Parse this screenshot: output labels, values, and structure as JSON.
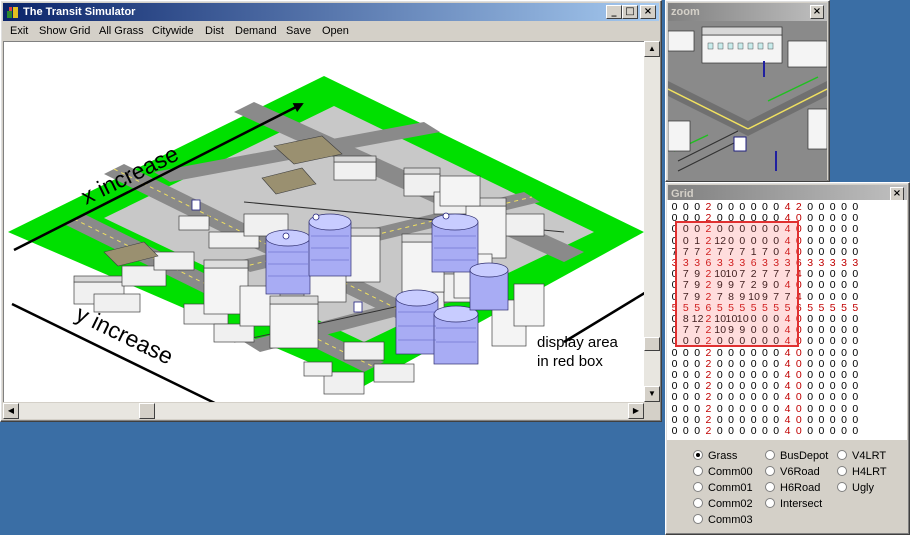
{
  "main_window": {
    "title": "The Transit Simulator",
    "menu": [
      "Exit",
      "Show Grid",
      "All Grass",
      "Citywide",
      "Dist",
      "Demand",
      "Save",
      "Open"
    ]
  },
  "zoom_window": {
    "title": "zoom"
  },
  "grid_window": {
    "title": "Grid",
    "rows": [
      [
        "0",
        "0",
        "0",
        "2",
        "0",
        "0",
        "0",
        "0",
        "0",
        "0",
        "4",
        "2",
        "0",
        "0",
        "0",
        "0",
        "0"
      ],
      [
        "0",
        "0",
        "0",
        "2",
        "0",
        "0",
        "0",
        "0",
        "0",
        "0",
        "4",
        "0",
        "0",
        "0",
        "0",
        "0",
        "0"
      ],
      [
        "0",
        "0",
        "0",
        "2",
        "0",
        "0",
        "0",
        "0",
        "0",
        "0",
        "4",
        "0",
        "0",
        "0",
        "0",
        "0",
        "0"
      ],
      [
        "0",
        "0",
        "1",
        "2",
        "12",
        "0",
        "0",
        "0",
        "0",
        "0",
        "4",
        "0",
        "0",
        "0",
        "0",
        "0",
        "0"
      ],
      [
        "7",
        "7",
        "7",
        "2",
        "7",
        "7",
        "7",
        "1",
        "7",
        "0",
        "4",
        "0",
        "0",
        "0",
        "0",
        "0",
        "0"
      ],
      [
        "3",
        "3",
        "3",
        "6",
        "3",
        "3",
        "3",
        "6",
        "3",
        "3",
        "3",
        "6",
        "3",
        "3",
        "3",
        "3",
        "3"
      ],
      [
        "0",
        "7",
        "9",
        "2",
        "10",
        "10",
        "7",
        "2",
        "7",
        "7",
        "7",
        "4",
        "0",
        "0",
        "0",
        "0",
        "0"
      ],
      [
        "0",
        "7",
        "9",
        "2",
        "9",
        "9",
        "7",
        "2",
        "9",
        "0",
        "4",
        "0",
        "0",
        "0",
        "0",
        "0",
        "0"
      ],
      [
        "0",
        "7",
        "9",
        "2",
        "7",
        "8",
        "9",
        "10",
        "9",
        "7",
        "7",
        "4",
        "0",
        "0",
        "0",
        "0",
        "0"
      ],
      [
        "5",
        "5",
        "5",
        "6",
        "5",
        "5",
        "5",
        "5",
        "5",
        "5",
        "5",
        "6",
        "5",
        "5",
        "5",
        "5",
        "5"
      ],
      [
        "0",
        "8",
        "12",
        "2",
        "10",
        "10",
        "10",
        "0",
        "0",
        "0",
        "4",
        "0",
        "0",
        "0",
        "0",
        "0",
        "0"
      ],
      [
        "0",
        "7",
        "7",
        "2",
        "10",
        "9",
        "9",
        "0",
        "0",
        "0",
        "4",
        "0",
        "0",
        "0",
        "0",
        "0",
        "0"
      ],
      [
        "0",
        "0",
        "0",
        "2",
        "0",
        "0",
        "0",
        "0",
        "0",
        "0",
        "4",
        "0",
        "0",
        "0",
        "0",
        "0",
        "0"
      ],
      [
        "0",
        "0",
        "0",
        "2",
        "0",
        "0",
        "0",
        "0",
        "0",
        "0",
        "4",
        "0",
        "0",
        "0",
        "0",
        "0",
        "0"
      ],
      [
        "0",
        "0",
        "0",
        "2",
        "0",
        "0",
        "0",
        "0",
        "0",
        "0",
        "4",
        "0",
        "0",
        "0",
        "0",
        "0",
        "0"
      ],
      [
        "0",
        "0",
        "0",
        "2",
        "0",
        "0",
        "0",
        "0",
        "0",
        "0",
        "4",
        "0",
        "0",
        "0",
        "0",
        "0",
        "0"
      ],
      [
        "0",
        "0",
        "0",
        "2",
        "0",
        "0",
        "0",
        "0",
        "0",
        "0",
        "4",
        "0",
        "0",
        "0",
        "0",
        "0",
        "0"
      ],
      [
        "0",
        "0",
        "0",
        "2",
        "0",
        "0",
        "0",
        "0",
        "0",
        "0",
        "4",
        "0",
        "0",
        "0",
        "0",
        "0",
        "0"
      ],
      [
        "0",
        "0",
        "0",
        "2",
        "0",
        "0",
        "0",
        "0",
        "0",
        "0",
        "4",
        "0",
        "0",
        "0",
        "0",
        "0",
        "0"
      ],
      [
        "0",
        "0",
        "0",
        "2",
        "0",
        "0",
        "0",
        "0",
        "0",
        "0",
        "4",
        "0",
        "0",
        "0",
        "0",
        "0",
        "0"
      ],
      [
        "0",
        "0",
        "0",
        "2",
        "0",
        "0",
        "0",
        "0",
        "0",
        "0",
        "4",
        "0",
        "0",
        "0",
        "0",
        "0",
        "0"
      ]
    ],
    "radio_options": [
      {
        "label": "Grass",
        "selected": true
      },
      {
        "label": "Comm00",
        "selected": false
      },
      {
        "label": "Comm01",
        "selected": false
      },
      {
        "label": "Comm02",
        "selected": false
      },
      {
        "label": "Comm03",
        "selected": false
      },
      {
        "label": "BusDepot",
        "selected": false
      },
      {
        "label": "V6Road",
        "selected": false
      },
      {
        "label": "H6Road",
        "selected": false
      },
      {
        "label": "Intersect",
        "selected": false
      },
      {
        "label": "V4LRT",
        "selected": false
      },
      {
        "label": "H4LRT",
        "selected": false
      },
      {
        "label": "Ugly",
        "selected": false
      }
    ]
  },
  "annotations": {
    "x_increase": "x increase",
    "y_increase": "y increase",
    "display_line1": "display area",
    "display_line2": "in red box"
  },
  "colors": {
    "titlebar_active": "#0a246a",
    "grass": "#00e000",
    "road": "#9a9a9a",
    "building": "#e8e8e8",
    "tower": "#9a9ef0",
    "red_highlight": "#e03030",
    "desktop": "#3a6ea5"
  }
}
